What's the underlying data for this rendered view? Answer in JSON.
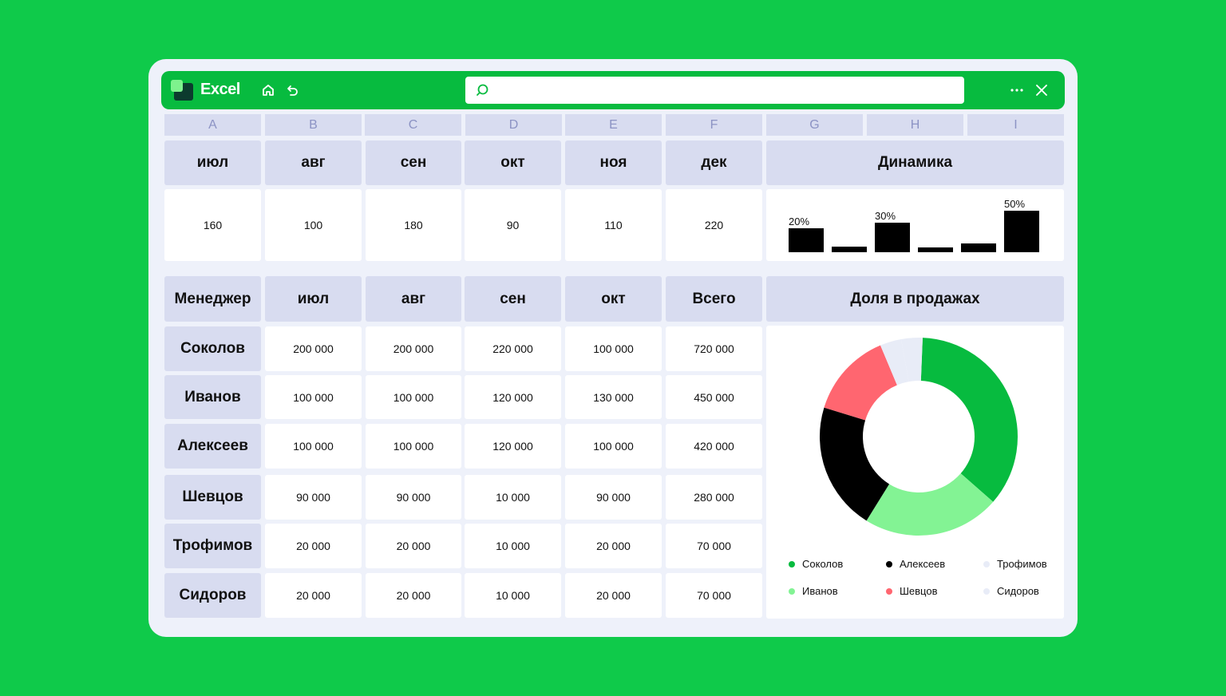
{
  "app": {
    "title": "Excel"
  },
  "toolbar": {
    "home_icon": "home-icon",
    "undo_icon": "undo-icon",
    "more_icon": "more-icon",
    "close_icon": "close-icon"
  },
  "search": {
    "placeholder": "",
    "value": ""
  },
  "columns": [
    "A",
    "B",
    "C",
    "D",
    "E",
    "F",
    "G",
    "H",
    "I"
  ],
  "top_table": {
    "months": [
      "июл",
      "авг",
      "сен",
      "окт",
      "ноя",
      "дек"
    ],
    "values": [
      "160",
      "100",
      "180",
      "90",
      "110",
      "220"
    ],
    "dynamics_label": "Динамика"
  },
  "sales_table": {
    "headers": [
      "Менеджер",
      "июл",
      "авг",
      "сен",
      "окт",
      "Всего"
    ],
    "share_label": "Доля в продажах",
    "rows": [
      {
        "name": "Соколов",
        "values": [
          "200 000",
          "200 000",
          "220 000",
          "100 000",
          "720 000"
        ]
      },
      {
        "name": "Иванов",
        "values": [
          "100 000",
          "100 000",
          "120 000",
          "130 000",
          "450 000"
        ]
      },
      {
        "name": "Алексеев",
        "values": [
          "100 000",
          "100 000",
          "120 000",
          "100 000",
          "420 000"
        ]
      },
      {
        "name": "Шевцов",
        "values": [
          "90 000",
          "90 000",
          "10 000",
          "90 000",
          "280 000"
        ]
      },
      {
        "name": "Трофимов",
        "values": [
          "20 000",
          "20 000",
          "10 000",
          "20 000",
          "70 000"
        ]
      },
      {
        "name": "Сидоров",
        "values": [
          "20 000",
          "20 000",
          "10 000",
          "20 000",
          "70 000"
        ]
      }
    ]
  },
  "colors": {
    "brand": "#07bb3f",
    "background": "#0fca4a",
    "header": "#d8dcf0"
  },
  "chart_data": [
    {
      "type": "bar",
      "title": "Динамика",
      "categories": [
        "июл",
        "авг",
        "сен",
        "окт",
        "ноя",
        "дек"
      ],
      "values": [
        160,
        100,
        180,
        90,
        110,
        220
      ],
      "data_labels": [
        "20%",
        "",
        "30%",
        "",
        "",
        "50%"
      ]
    },
    {
      "type": "pie",
      "title": "Доля в продажах",
      "labels": [
        "Соколов",
        "Иванов",
        "Алексеев",
        "Шевцов",
        "Трофимов",
        "Сидоров"
      ],
      "values": [
        720000,
        450000,
        420000,
        280000,
        70000,
        70000
      ],
      "colors": [
        "#07bb3f",
        "#83f394",
        "#000000",
        "#ff6670",
        "#e8ecf7",
        "#e8ecf7"
      ]
    }
  ]
}
